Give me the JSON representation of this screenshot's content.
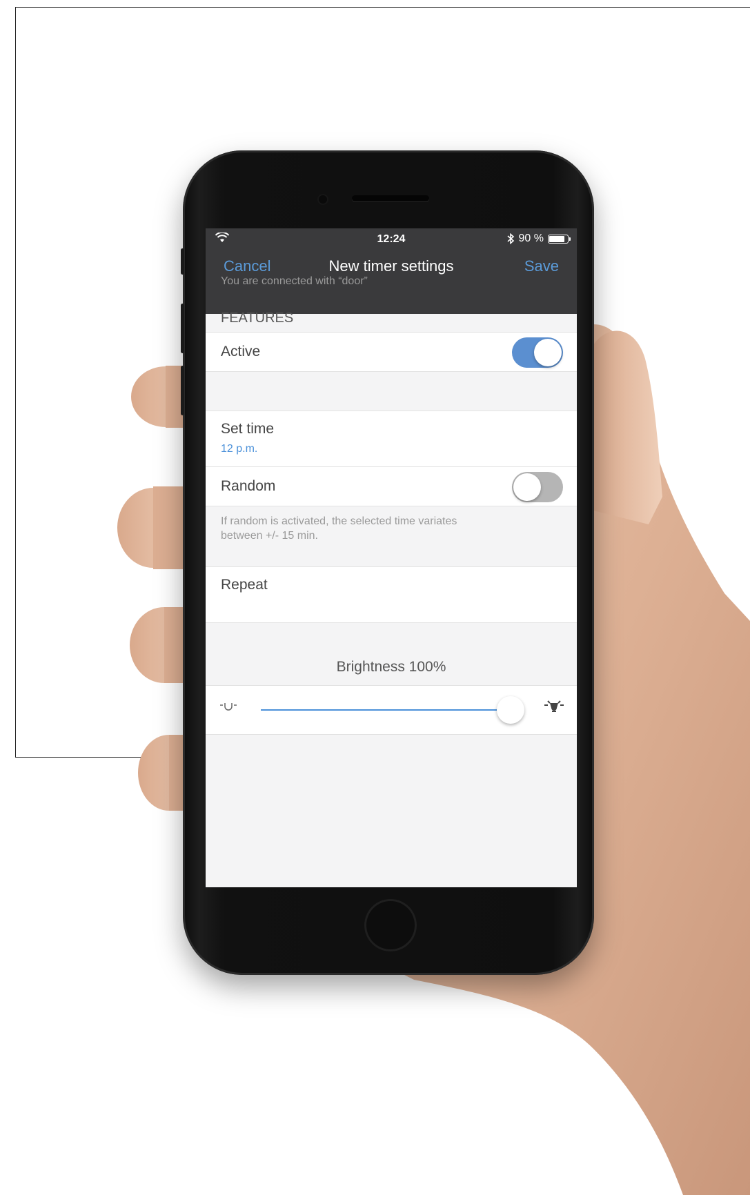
{
  "status_bar": {
    "time": "12:24",
    "battery_text": "90 %",
    "battery_level": 0.9,
    "icons": [
      "wifi-icon",
      "bluetooth-icon",
      "battery-icon"
    ]
  },
  "nav": {
    "cancel_label": "Cancel",
    "title": "New timer settings",
    "save_label": "Save"
  },
  "connection_info": "You are connected with “door”",
  "features_header": "FEATURES",
  "active": {
    "label": "Active",
    "on": true
  },
  "set_time": {
    "label": "Set time",
    "value": "12 p.m."
  },
  "random": {
    "label": "Random",
    "on": false,
    "note": "If random is activated, the selected time variates between +/- 15 min."
  },
  "repeat": {
    "label": "Repeat"
  },
  "brightness": {
    "label": "Brightness 100%",
    "value": 1.0,
    "dim_icon": "bulb-dim-icon",
    "bright_icon": "bulb-bright-icon"
  },
  "colors": {
    "accent": "#4a90d9",
    "nav_background": "#3a3a3c",
    "toggle_on": "#5b8fd0",
    "toggle_off": "#b5b5b5"
  }
}
